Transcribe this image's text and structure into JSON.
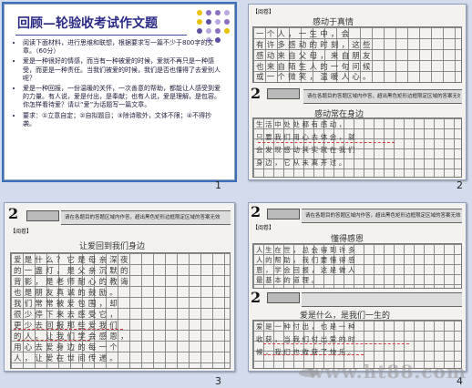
{
  "slides": [
    {
      "number": "1",
      "title": "回顾—轮验收考试作文题",
      "bullets": [
        "阅读下面材料，进行思维和联想，根据要求写一篇不少于800字的文章。（60分）",
        "爱是一种很好的情感，而当有一种被爱的时候，爱就不再只是一种感受，而更是一种责任。当我们被爱的时候，我们是否也懂得了去爱别人呢？",
        "爱是一种回报，一份温暖的关怀，一次善意的帮助，都能让人感受到爱的力量。有人说，爱是付出，是奉献；也有人说，爱是理解，是包容。你怎样看待爱？请以“爱”为话题写一篇文章。",
        "要求：①立意自定；②自拟题目；③除诗歌外，文体不限；④不得抄袭。"
      ]
    },
    {
      "number": "2",
      "essay_titles": [
        "感动于真情",
        "感动常在身边"
      ],
      "lines_top": [
        "一个人，一生中，会",
        "有许多感动的时刻，这些",
        "感动来自父母，来自朋友",
        "也来自陌生人的一句问候",
        "或一个微笑，温暖人心。"
      ],
      "lines_bottom": [
        "生活中处处都有感动，",
        "只要我们用心去体会，就",
        "会发现感动其实就在我们",
        "身边，它从未离开过。"
      ],
      "header_band": "请在各题目的答题区域内作答，超出黑色矩形边框限定区域的答案无效",
      "tag_label": "【阅卷】"
    },
    {
      "number": "3",
      "essay_title": "让爱回到我们身边",
      "lines": [
        "爱是什么？它是母亲深夜",
        "的一盏灯，是父亲沉默的",
        "背影，是老师耐心的教诲",
        "也是朋友真诚的鼓励。",
        "我们常常被爱包围，却",
        "很少停下来去感受它，",
        "更少去回报那些爱我们",
        "的人。让我们学会感恩，",
        "用心去爱身边的每一个",
        "人，让爱在世间传递。"
      ],
      "header_band": "请在各题目的答题区域内作答，超出黑色矩形边框限定区域的答案无效",
      "tag_label": "【阅卷】"
    },
    {
      "number": "4",
      "essay_titles": [
        "懂得感恩",
        "爱是什么，是我们一生的"
      ],
      "lines_top": [
        "人生在世，总会得到许多",
        "人的帮助，我们要懂得感",
        "恩，学会回报，这是做人",
        "最基本的道理。"
      ],
      "lines_bottom": [
        "爱是一种付出，也是一种",
        "收获，当我们付出爱的时",
        "候，我们也收获了快乐。"
      ],
      "header_band": "请在各题目的答题区域内作答，超出黑色矩形边框限定区域的答案无效",
      "tag_label": "【阅卷】"
    }
  ],
  "watermark": "www.ht88.com",
  "colors": {
    "pane_background": "#d2dcec",
    "title_color": "#2a2a86",
    "dot_colors": [
      "#e8c200",
      "#8b6fc0",
      "#5a4fa0",
      "#b8a8dc"
    ]
  }
}
